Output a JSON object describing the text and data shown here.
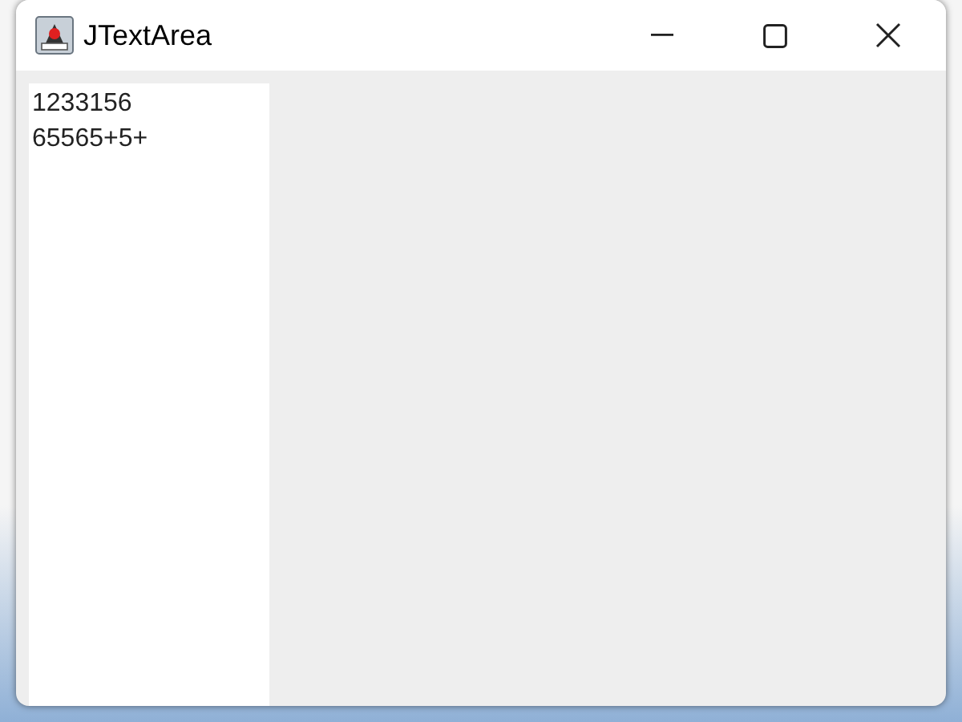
{
  "window": {
    "title": "JTextArea"
  },
  "text_area": {
    "value": "1233156\n65565+5+"
  }
}
